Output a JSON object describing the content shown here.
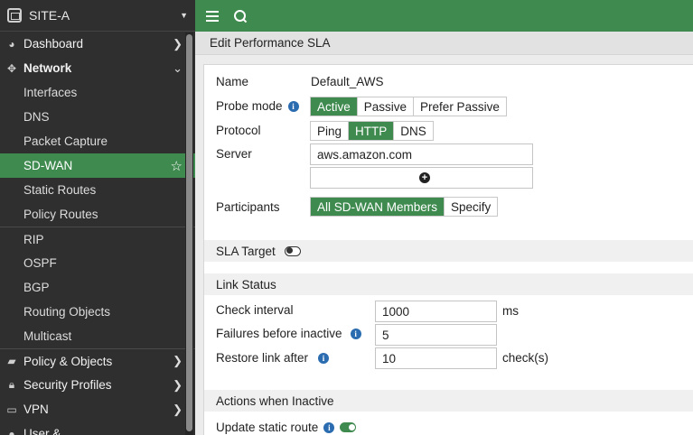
{
  "sidebar": {
    "device_name": "SITE-A",
    "items": [
      {
        "label": "Dashboard",
        "icon": "dashboard-icon",
        "chevron": "›"
      },
      {
        "label": "Network",
        "icon": "network-icon",
        "chevron": "⌄"
      },
      {
        "label": "Interfaces"
      },
      {
        "label": "DNS"
      },
      {
        "label": "Packet Capture"
      },
      {
        "label": "SD-WAN"
      },
      {
        "label": "Static Routes"
      },
      {
        "label": "Policy Routes"
      },
      {
        "label": "RIP"
      },
      {
        "label": "OSPF"
      },
      {
        "label": "BGP"
      },
      {
        "label": "Routing Objects"
      },
      {
        "label": "Multicast"
      },
      {
        "label": "Policy & Objects",
        "icon": "policy-icon",
        "chevron": "›"
      },
      {
        "label": "Security Profiles",
        "icon": "lock-icon",
        "chevron": "›"
      },
      {
        "label": "VPN",
        "icon": "vpn-icon",
        "chevron": "›"
      },
      {
        "label": "User &",
        "icon": "user-icon"
      }
    ]
  },
  "page": {
    "title": "Edit Performance SLA"
  },
  "form": {
    "name_label": "Name",
    "name_value": "Default_AWS",
    "probe_mode_label": "Probe mode",
    "probe_mode_options": [
      "Active",
      "Passive",
      "Prefer Passive"
    ],
    "probe_mode_selected": "Active",
    "protocol_label": "Protocol",
    "protocol_options": [
      "Ping",
      "HTTP",
      "DNS"
    ],
    "protocol_selected": "HTTP",
    "server_label": "Server",
    "server_value": "aws.amazon.com",
    "participants_label": "Participants",
    "participants_options": [
      "All SD-WAN Members",
      "Specify"
    ],
    "participants_selected": "All SD-WAN Members",
    "sla_target_label": "SLA Target",
    "sla_target_enabled": false,
    "link_status_title": "Link Status",
    "check_interval_label": "Check interval",
    "check_interval_value": "1000",
    "check_interval_unit": "ms",
    "failures_label": "Failures before inactive",
    "failures_value": "5",
    "restore_label": "Restore link after",
    "restore_value": "10",
    "restore_unit": "check(s)",
    "actions_title": "Actions when Inactive",
    "update_static_route_label": "Update static route",
    "update_static_route_enabled": true
  },
  "colors": {
    "accent": "#3f8a4f",
    "sidebar_bg": "#2f2f2f",
    "info_icon": "#2b6cb0"
  }
}
